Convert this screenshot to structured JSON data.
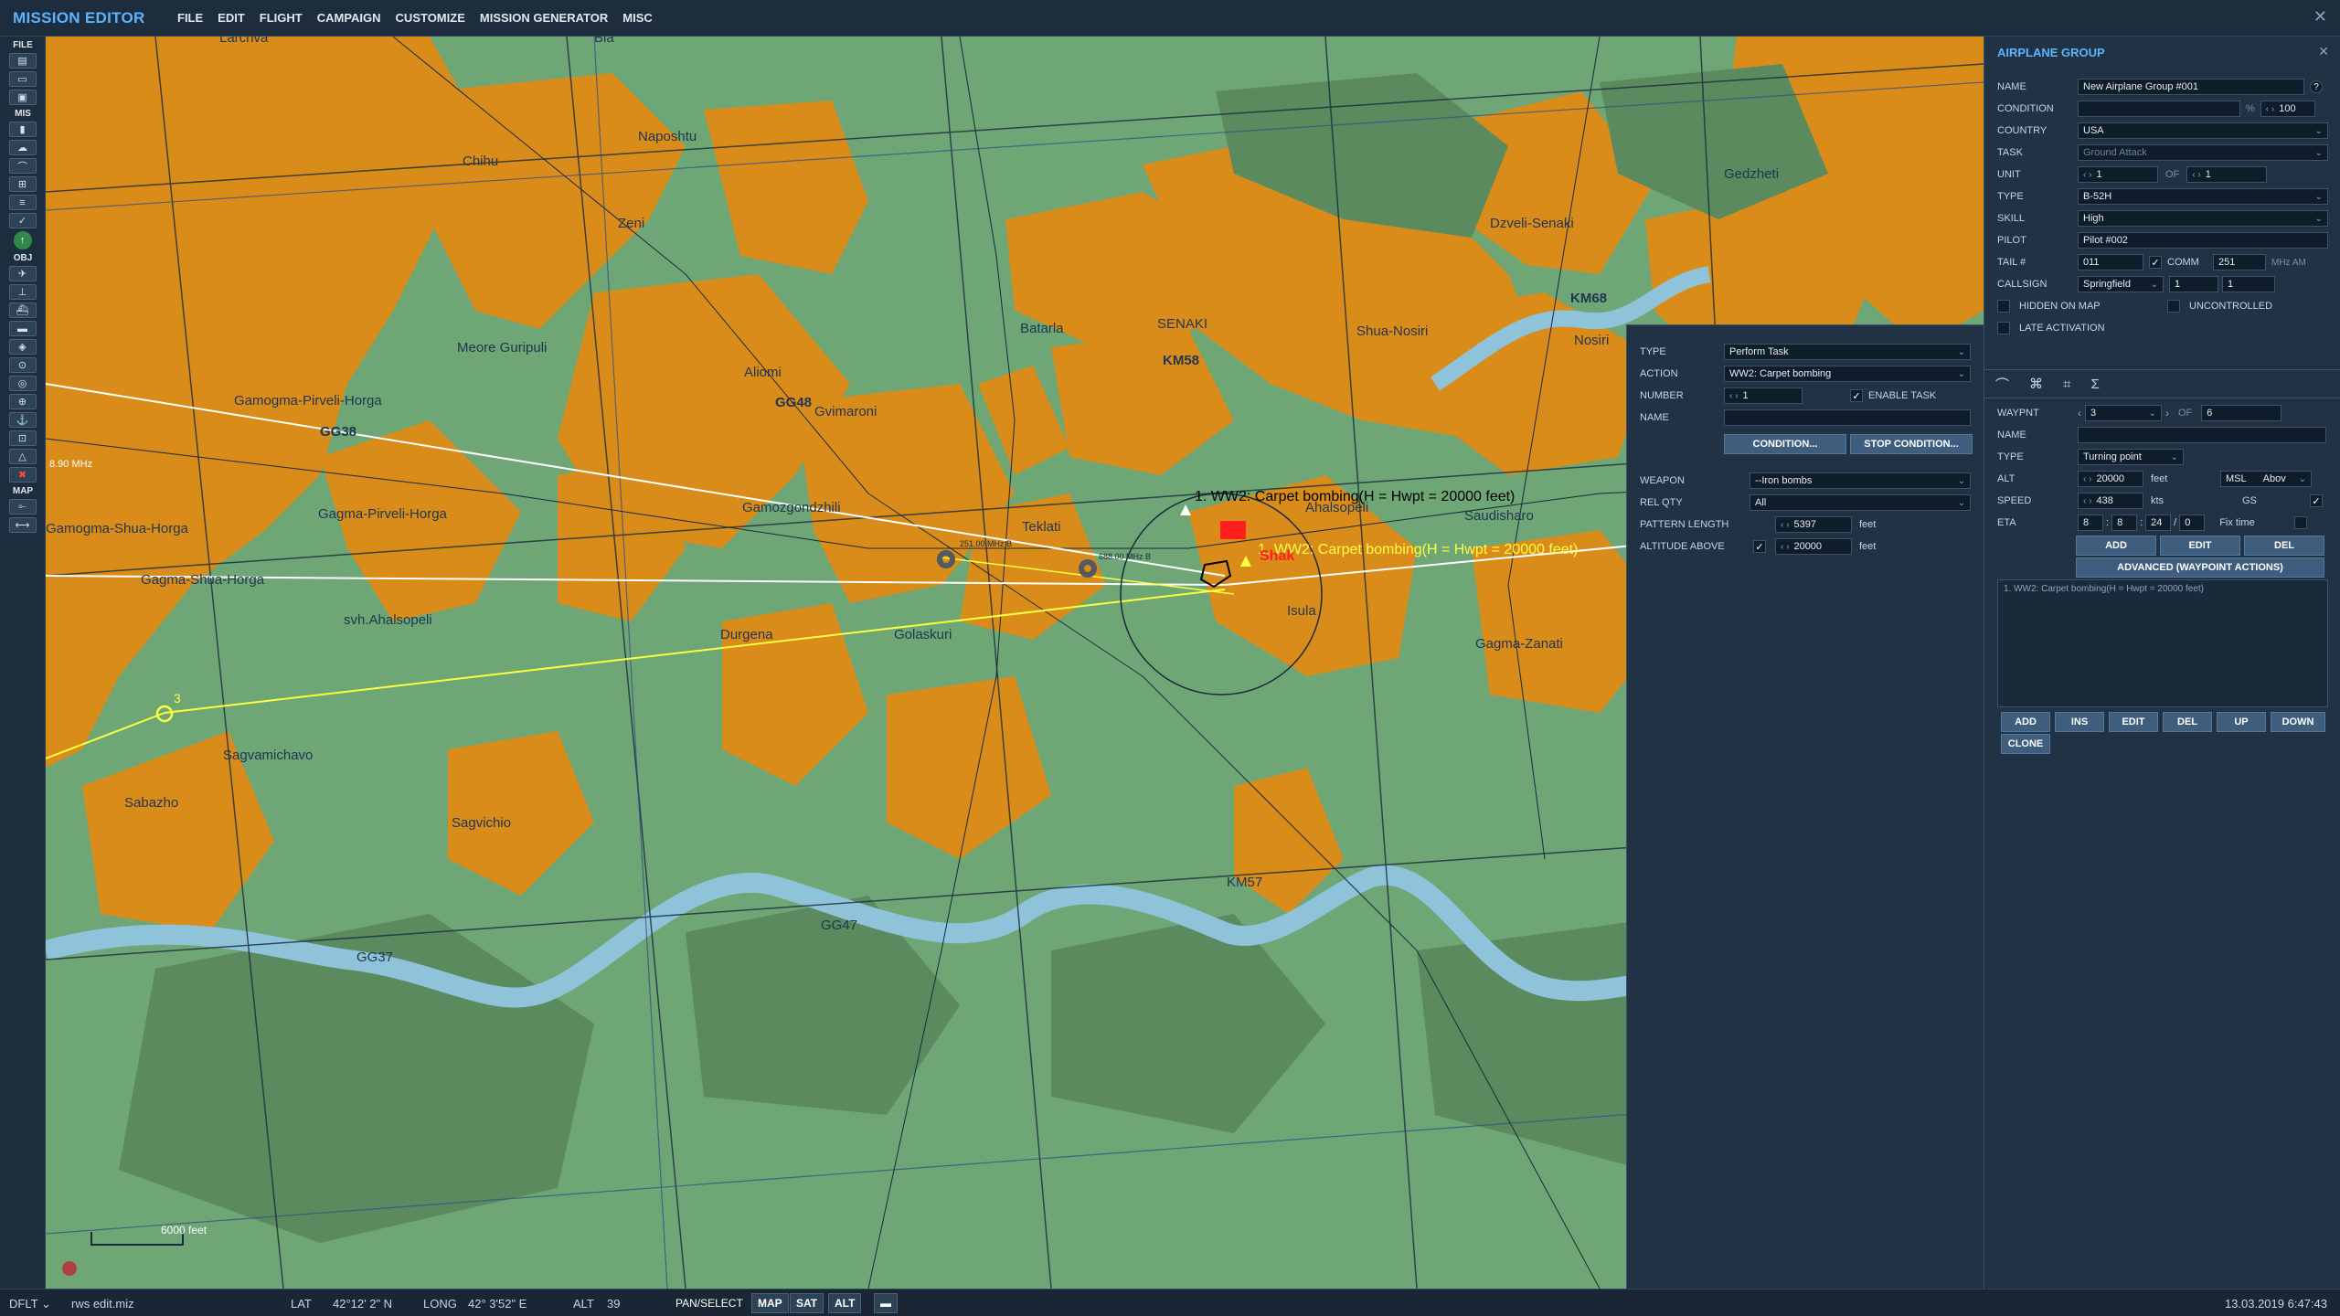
{
  "app": {
    "title": "MISSION EDITOR",
    "close_icon": "x-icon"
  },
  "menu": [
    "FILE",
    "EDIT",
    "FLIGHT",
    "CAMPAIGN",
    "CUSTOMIZE",
    "MISSION GENERATOR",
    "MISC"
  ],
  "toolbar": {
    "file_label": "FILE",
    "mis_label": "MIS",
    "obj_label": "OBJ",
    "map_label": "MAP"
  },
  "map": {
    "towns": [
      "Larchva",
      "Bia",
      "Naposhtu",
      "Chihu",
      "Zeni",
      "Meore Guripuli",
      "Gamogma-Pirveli-Horga",
      "Aliomi",
      "Gvimaroni",
      "Batarla",
      "SENAKI",
      "Shua-Nosiri",
      "Dzveli-Senaki",
      "Gedzheti",
      "Nosiri",
      "Gagma-Pirveli-Horga",
      "Gamogma-Shua-Horga",
      "Gagma-Shua-Horga",
      "Gamozgondzhili",
      "Teklati",
      "Ahalsopeli",
      "Saudisharo",
      "svh.Ahalsopeli",
      "Durgena",
      "Golaskuri",
      "Isula",
      "Gagma-Zanati",
      "Sagvamichavo",
      "Sabazho",
      "Sagvichio",
      "KM57",
      "GG37",
      "GG47"
    ],
    "grid_labels": [
      "GG38",
      "GG48",
      "KM58",
      "KM68"
    ],
    "route_label_1": "1. WW2: Carpet bombing(H = Hwpt = 20000 feet)",
    "route_label_2": "1. WW2: Carpet bombing(H = Hwpt = 20000 feet)",
    "target_label": "Shak",
    "wp_number": "3",
    "freq_label": "8.90 MHz",
    "wp_freq_1": "251.00 MHz B",
    "wp_freq_2": "688.00 MHz B",
    "scale_label": "6000 feet"
  },
  "task": {
    "type_label": "TYPE",
    "type_value": "Perform Task",
    "action_label": "ACTION",
    "action_value": "WW2: Carpet bombing",
    "number_label": "NUMBER",
    "number_value": "1",
    "enable_label": "ENABLE TASK",
    "name_label": "NAME",
    "name_value": "",
    "condition_btn": "CONDITION...",
    "stop_condition_btn": "STOP CONDITION...",
    "weapon_label": "WEAPON",
    "weapon_value": "--Iron bombs",
    "relqty_label": "REL QTY",
    "relqty_value": "All",
    "pattern_label": "PATTERN LENGTH",
    "pattern_value": "5397",
    "pattern_unit": "feet",
    "altitude_label": "ALTITUDE ABOVE",
    "altitude_value": "20000",
    "altitude_unit": "feet"
  },
  "group": {
    "title": "AIRPLANE GROUP",
    "name_label": "NAME",
    "name_value": "New Airplane Group #001",
    "help": "?",
    "condition_label": "CONDITION",
    "condition_value": "",
    "pct": "%",
    "pct_value": "100",
    "country_label": "COUNTRY",
    "country_value": "USA",
    "task_label": "TASK",
    "task_value": "Ground Attack",
    "unit_label": "UNIT",
    "unit_value": "1",
    "of_label": "OF",
    "unit_of_value": "1",
    "type_label": "TYPE",
    "type_value": "B-52H",
    "skill_label": "SKILL",
    "skill_value": "High",
    "pilot_label": "PILOT",
    "pilot_value": "Pilot #002",
    "tail_label": "TAIL #",
    "tail_value": "011",
    "comm_label": "COMM",
    "comm_value": "251",
    "comm_unit": "MHz AM",
    "callsign_label": "CALLSIGN",
    "callsign_value": "Springfield",
    "callsign_n1": "1",
    "callsign_n2": "1",
    "hidden_label": "HIDDEN ON MAP",
    "uncontrolled_label": "UNCONTROLLED",
    "late_label": "LATE ACTIVATION"
  },
  "waypoint": {
    "wp_label": "WAYPNT",
    "wp_value": "3",
    "of_label": "OF",
    "of_value": "6",
    "name_label": "NAME",
    "name_value": "",
    "type_label": "TYPE",
    "type_value": "Turning point",
    "alt_label": "ALT",
    "alt_value": "20000",
    "alt_unit": "feet",
    "msl": "MSL",
    "above": "Abov",
    "speed_label": "SPEED",
    "speed_value": "438",
    "speed_unit": "kts",
    "gs": "GS",
    "eta_label": "ETA",
    "eta_d": "8",
    "eta_h": "8",
    "eta_m": "24",
    "eta_s": "0",
    "fix_label": "Fix time",
    "add_btn": "ADD",
    "edit_btn": "EDIT",
    "del_btn": "DEL",
    "advanced_btn": "ADVANCED (WAYPOINT ACTIONS)",
    "actions": [
      "1. WW2: Carpet bombing(H = Hwpt = 20000 feet)"
    ],
    "buttons": [
      "ADD",
      "INS",
      "EDIT",
      "DEL",
      "UP",
      "DOWN",
      "CLONE"
    ]
  },
  "status": {
    "profile": "DFLT",
    "file": "rws edit.miz",
    "lat_label": "LAT",
    "lat_value": "42°12' 2\" N",
    "long_label": "LONG",
    "long_value": "42° 3'52\" E",
    "alt_label": "ALT",
    "alt_value": "39",
    "pan_btn": "PAN/SELECT",
    "map_btn": "MAP",
    "sat_btn": "SAT",
    "alt_btn": "ALT",
    "datetime": "13.03.2019 6:47:43"
  },
  "colors": {
    "accent": "#5ab4ff",
    "land": "#6ea676",
    "urban": "#d98c1a",
    "forest": "#5a8a5e",
    "water": "#8fc3d9",
    "route_yellow": "#ffff40",
    "target_red": "#ff1f1f"
  }
}
